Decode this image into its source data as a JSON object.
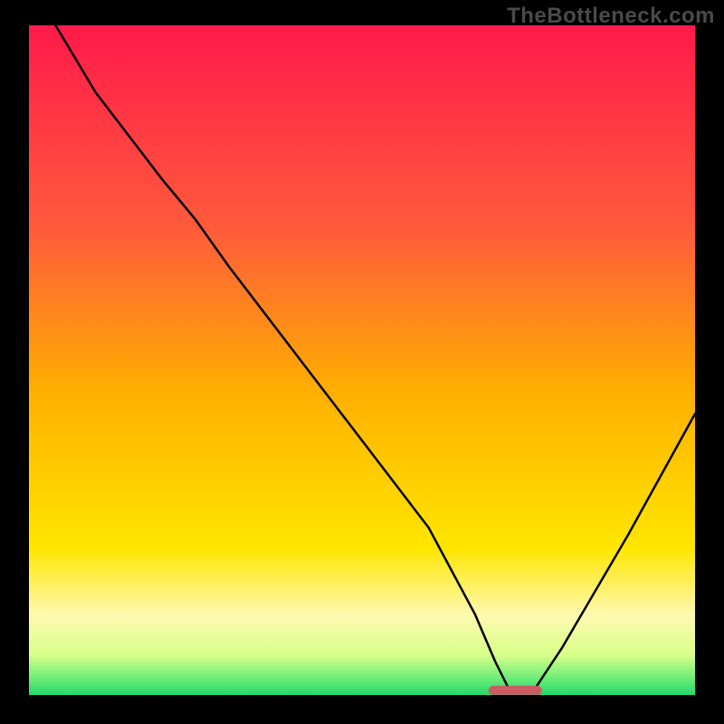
{
  "watermark": "TheBottleneck.com",
  "chart_data": {
    "type": "line",
    "title": "",
    "xlabel": "",
    "ylabel": "",
    "xlim": [
      0,
      100
    ],
    "ylim": [
      0,
      100
    ],
    "grid": false,
    "legend": false,
    "series": [
      {
        "name": "bottleneck-curve",
        "x": [
          4,
          10,
          20,
          25,
          30,
          40,
          50,
          60,
          67,
          70,
          72,
          76,
          80,
          90,
          100
        ],
        "values": [
          100,
          90,
          77,
          71,
          64,
          51,
          38,
          25,
          12,
          5,
          1,
          1,
          7,
          24,
          42
        ]
      }
    ],
    "marker": {
      "name": "optimal-range-bar",
      "x_start": 69,
      "x_end": 77,
      "y": 0.7,
      "color": "#cc5a63"
    },
    "gradient_stops": [
      {
        "offset": 0,
        "color": "#ff1a4a"
      },
      {
        "offset": 30,
        "color": "#ff5a3c"
      },
      {
        "offset": 55,
        "color": "#ffb000"
      },
      {
        "offset": 78,
        "color": "#ffe600"
      },
      {
        "offset": 88,
        "color": "#fff9b0"
      },
      {
        "offset": 94,
        "color": "#d8ff8a"
      },
      {
        "offset": 97,
        "color": "#7df07a"
      },
      {
        "offset": 100,
        "color": "#23d86b"
      }
    ]
  }
}
